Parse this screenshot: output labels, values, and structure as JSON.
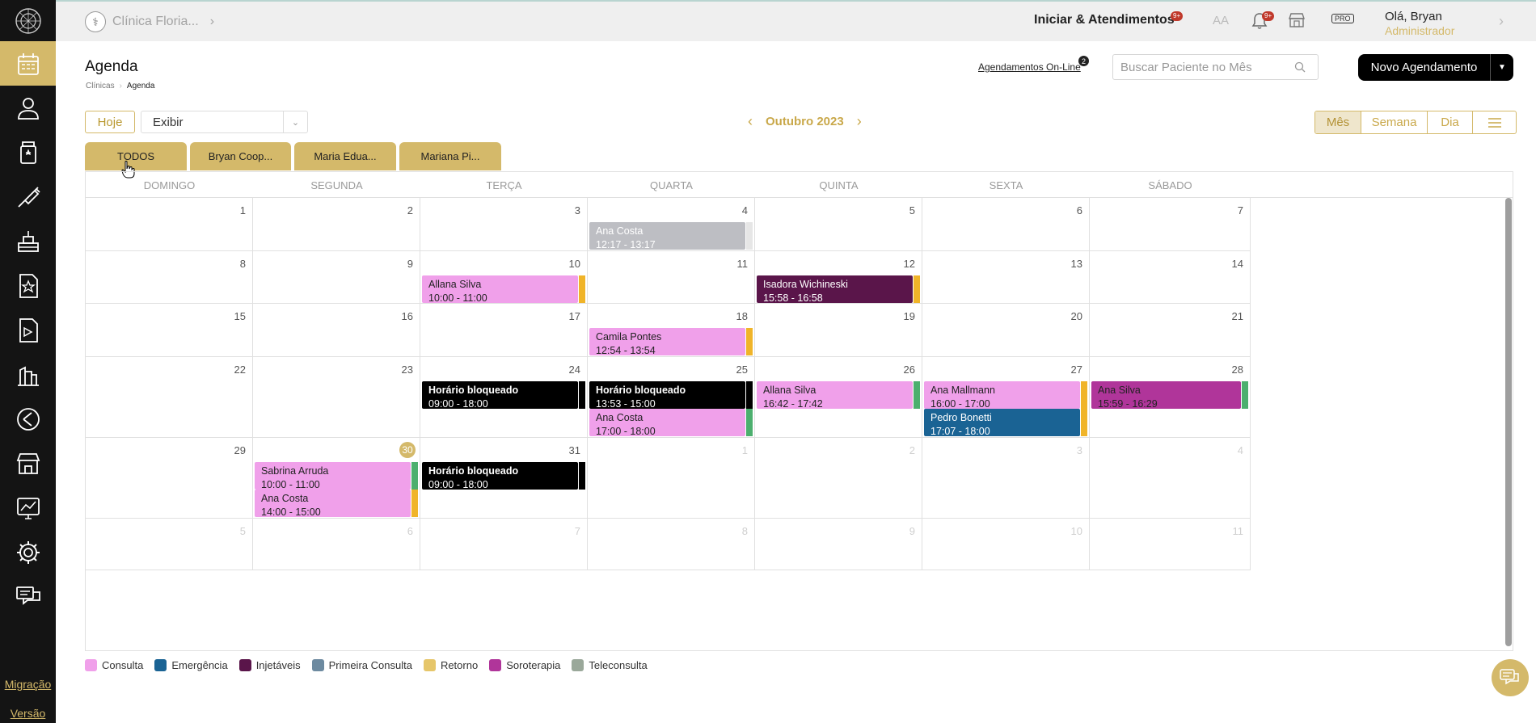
{
  "sidebar": {
    "items": [
      {
        "icon": "calendar-icon"
      },
      {
        "icon": "patient-icon"
      },
      {
        "icon": "medicine-bottle-icon"
      },
      {
        "icon": "syringe-icon"
      },
      {
        "icon": "procedures-icon"
      },
      {
        "icon": "certificate-icon"
      },
      {
        "icon": "report-icon"
      },
      {
        "icon": "building-icon"
      },
      {
        "icon": "chart-arrow-icon"
      },
      {
        "icon": "store-icon"
      },
      {
        "icon": "finance-icon"
      },
      {
        "icon": "gear-icon"
      },
      {
        "icon": "chat-icon"
      }
    ],
    "migracao": "Migração",
    "versao": "Versão"
  },
  "topbar": {
    "clinic": "Clínica Floria...",
    "iniciar": "Iniciar & Atendimentos",
    "iniciar_badge": "9+",
    "font_size_label": "AA",
    "bell_badge": "9+",
    "pro_label": "PRO",
    "user_greeting": "Olá, Bryan",
    "user_role": "Administrador"
  },
  "header": {
    "title": "Agenda",
    "breadcrumb": [
      "Clínicas",
      "Agenda"
    ],
    "online_link": "Agendamentos On-Line",
    "online_badge": "2",
    "search_placeholder": "Buscar Paciente no Mês",
    "new_button": "Novo Agendamento"
  },
  "toolbar": {
    "today": "Hoje",
    "exibir": "Exibir",
    "month": "Outubro 2023",
    "views": [
      "Mês",
      "Semana",
      "Dia"
    ]
  },
  "tabs": [
    "TODOS",
    "Bryan Coop...",
    "Maria Edua...",
    "Mariana Pi..."
  ],
  "calendar": {
    "weekdays": [
      "DOMINGO",
      "SEGUNDA",
      "TERÇA",
      "QUARTA",
      "QUINTA",
      "SEXTA",
      "SÁBADO"
    ],
    "weeks": [
      [
        {
          "d": "1"
        },
        {
          "d": "2"
        },
        {
          "d": "3"
        },
        {
          "d": "4"
        },
        {
          "d": "5"
        },
        {
          "d": "6"
        },
        {
          "d": "7"
        }
      ],
      [
        {
          "d": "8"
        },
        {
          "d": "9"
        },
        {
          "d": "10"
        },
        {
          "d": "11"
        },
        {
          "d": "12"
        },
        {
          "d": "13"
        },
        {
          "d": "14"
        }
      ],
      [
        {
          "d": "15"
        },
        {
          "d": "16"
        },
        {
          "d": "17"
        },
        {
          "d": "18"
        },
        {
          "d": "19"
        },
        {
          "d": "20"
        },
        {
          "d": "21"
        }
      ],
      [
        {
          "d": "22"
        },
        {
          "d": "23"
        },
        {
          "d": "24"
        },
        {
          "d": "25"
        },
        {
          "d": "26"
        },
        {
          "d": "27"
        },
        {
          "d": "28"
        }
      ],
      [
        {
          "d": "29"
        },
        {
          "d": "30",
          "today": true
        },
        {
          "d": "31"
        },
        {
          "d": "1",
          "other": true
        },
        {
          "d": "2",
          "other": true
        },
        {
          "d": "3",
          "other": true
        },
        {
          "d": "4",
          "other": true
        }
      ],
      [
        {
          "d": "5",
          "other": true
        },
        {
          "d": "6",
          "other": true
        },
        {
          "d": "7",
          "other": true
        },
        {
          "d": "8",
          "other": true
        },
        {
          "d": "9",
          "other": true
        },
        {
          "d": "10",
          "other": true
        },
        {
          "d": "11",
          "other": true
        }
      ]
    ],
    "events": [
      {
        "week": 0,
        "day": 3,
        "slot": 0,
        "name": "Ana Costa",
        "time": "12:17 - 13:17",
        "bg": "#bdbec3",
        "fg": "#ffffff",
        "stripe": "#e6e6e6"
      },
      {
        "week": 1,
        "day": 2,
        "slot": 0,
        "name": "Allana Silva",
        "time": "10:00 - 11:00",
        "bg": "#f0a0ea",
        "fg": "#222222",
        "stripe": "#f0b429"
      },
      {
        "week": 1,
        "day": 4,
        "slot": 0,
        "name": "Isadora Wichineski",
        "time": "15:58 - 16:58",
        "bg": "#5a154a",
        "fg": "#ffffff",
        "stripe": "#f0b429"
      },
      {
        "week": 2,
        "day": 3,
        "slot": 0,
        "name": "Camila Pontes",
        "time": "12:54 - 13:54",
        "bg": "#f0a0ea",
        "fg": "#222222",
        "stripe": "#f0b429"
      },
      {
        "week": 3,
        "day": 2,
        "slot": 0,
        "name": "Horário bloqueado",
        "time": "09:00 - 18:00",
        "bg": "#000000",
        "fg": "#ffffff",
        "bold": true,
        "stripe": "#000000"
      },
      {
        "week": 3,
        "day": 3,
        "slot": 0,
        "name": "Horário bloqueado",
        "time": "13:53 - 15:00",
        "bg": "#000000",
        "fg": "#ffffff",
        "bold": true,
        "stripe": "#000000"
      },
      {
        "week": 3,
        "day": 3,
        "slot": 1,
        "name": "Ana Costa",
        "time": "17:00 - 18:00",
        "bg": "#f0a0ea",
        "fg": "#222222",
        "stripe": "#4caf6e"
      },
      {
        "week": 3,
        "day": 4,
        "slot": 0,
        "name": "Allana Silva",
        "time": "16:42 - 17:42",
        "bg": "#f0a0ea",
        "fg": "#222222",
        "stripe": "#4caf6e"
      },
      {
        "week": 3,
        "day": 5,
        "slot": 0,
        "name": "Ana Mallmann",
        "time": "16:00 - 17:00",
        "bg": "#f0a0ea",
        "fg": "#222222",
        "stripe": "#f0b429"
      },
      {
        "week": 3,
        "day": 5,
        "slot": 1,
        "name": "Pedro Bonetti",
        "time": "17:07 - 18:00",
        "bg": "#1a6394",
        "fg": "#ffffff",
        "stripe": "#f0b429"
      },
      {
        "week": 3,
        "day": 6,
        "slot": 0,
        "name": "Ana Silva",
        "time": "15:59 - 16:29",
        "bg": "#b0359a",
        "fg": "#222222",
        "stripe": "#4caf6e"
      },
      {
        "week": 4,
        "day": 1,
        "slot": 0,
        "name": "Sabrina Arruda",
        "time": "10:00 - 11:00",
        "bg": "#f0a0ea",
        "fg": "#222222",
        "stripe": "#4caf6e"
      },
      {
        "week": 4,
        "day": 1,
        "slot": 1,
        "name": "Ana Costa",
        "time": "14:00 - 15:00",
        "bg": "#f0a0ea",
        "fg": "#222222",
        "stripe": "#f0b429"
      },
      {
        "week": 4,
        "day": 2,
        "slot": 0,
        "name": "Horário bloqueado",
        "time": "09:00 - 18:00",
        "bg": "#000000",
        "fg": "#ffffff",
        "bold": true,
        "stripe": "#000000"
      }
    ]
  },
  "legend": [
    {
      "label": "Consulta",
      "color": "#f0a0ea"
    },
    {
      "label": "Emergência",
      "color": "#1a6394"
    },
    {
      "label": "Injetáveis",
      "color": "#5a154a"
    },
    {
      "label": "Primeira Consulta",
      "color": "#6d8aa0"
    },
    {
      "label": "Retorno",
      "color": "#e6c66a"
    },
    {
      "label": "Soroterapia",
      "color": "#b0359a"
    },
    {
      "label": "Teleconsulta",
      "color": "#9aa89a"
    }
  ]
}
